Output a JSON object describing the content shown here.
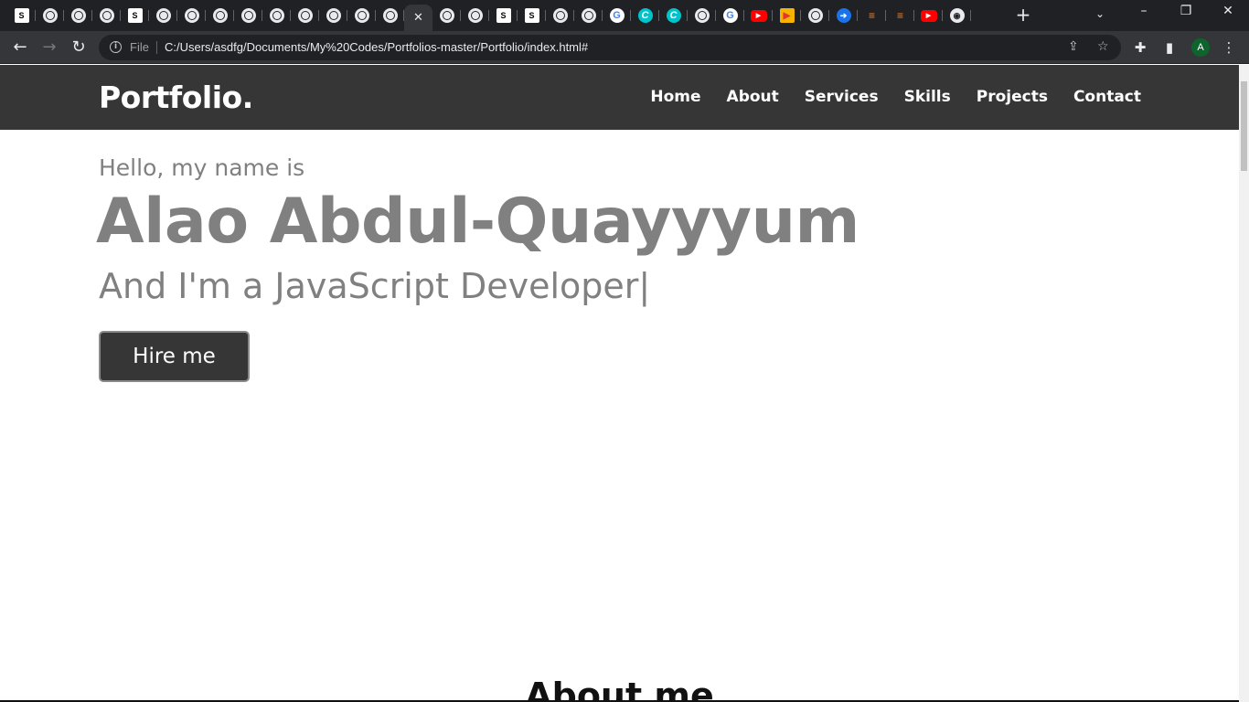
{
  "browser": {
    "tabs": [
      {
        "icon": "soft-icon",
        "glyph": "S"
      },
      {
        "icon": "globe-icon",
        "glyph": ""
      },
      {
        "icon": "globe-icon",
        "glyph": ""
      },
      {
        "icon": "globe-icon",
        "glyph": ""
      },
      {
        "icon": "soft-icon",
        "glyph": "S"
      },
      {
        "icon": "globe-icon",
        "glyph": ""
      },
      {
        "icon": "globe-icon",
        "glyph": ""
      },
      {
        "icon": "globe-icon",
        "glyph": ""
      },
      {
        "icon": "globe-icon",
        "glyph": ""
      },
      {
        "icon": "globe-icon",
        "glyph": ""
      },
      {
        "icon": "globe-icon",
        "glyph": ""
      },
      {
        "icon": "globe-icon",
        "glyph": ""
      },
      {
        "icon": "globe-icon",
        "glyph": ""
      },
      {
        "icon": "globe-icon",
        "glyph": ""
      },
      {
        "icon": "close-icon",
        "glyph": "✕",
        "active": true
      },
      {
        "icon": "globe-icon",
        "glyph": ""
      },
      {
        "icon": "globe-icon",
        "glyph": ""
      },
      {
        "icon": "soft-icon",
        "glyph": "S"
      },
      {
        "icon": "soft-icon",
        "glyph": "S"
      },
      {
        "icon": "globe-icon",
        "glyph": ""
      },
      {
        "icon": "globe-icon",
        "glyph": ""
      },
      {
        "icon": "google-icon",
        "glyph": "G"
      },
      {
        "icon": "canva-icon",
        "glyph": "C"
      },
      {
        "icon": "canva-icon",
        "glyph": "C"
      },
      {
        "icon": "globe-icon",
        "glyph": ""
      },
      {
        "icon": "google-icon",
        "glyph": "G"
      },
      {
        "icon": "youtube-icon",
        "glyph": "▶"
      },
      {
        "icon": "bookmark-icon",
        "glyph": "▶"
      },
      {
        "icon": "globe-icon",
        "glyph": ""
      },
      {
        "icon": "arrow-icon",
        "glyph": "➔"
      },
      {
        "icon": "stackoverflow-icon",
        "glyph": "≡"
      },
      {
        "icon": "stackoverflow-icon",
        "glyph": "≡"
      },
      {
        "icon": "youtube-icon",
        "glyph": "▶"
      },
      {
        "icon": "github-icon",
        "glyph": "◉"
      }
    ],
    "omnibox": {
      "scheme_label": "File",
      "url": "C:/Users/asdfg/Documents/My%20Codes/Portfolios-master/Portfolio/index.html#"
    },
    "profile_initial": "A"
  },
  "page": {
    "logo": "Portfolio.",
    "nav": [
      "Home",
      "About",
      "Services",
      "Skills",
      "Projects",
      "Contact"
    ],
    "hero": {
      "greeting": "Hello, my name is",
      "name": "Alao Abdul-Quayyyum",
      "role_prefix": "And I'm a ",
      "role": "JavaScript Developer",
      "cursor": "|",
      "cta": "Hire me"
    },
    "about_heading": "About me"
  },
  "colors": {
    "navbar_bg": "#363636",
    "hero_text": "#808080",
    "button_bg": "#363636"
  }
}
